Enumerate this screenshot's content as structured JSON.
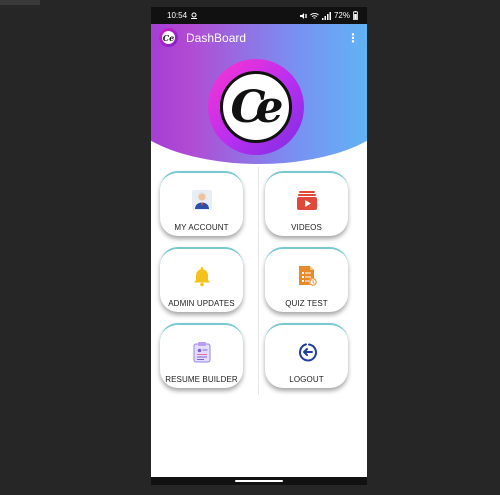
{
  "status_bar": {
    "time": "10:54",
    "battery": "72%",
    "icons": [
      "carrier-icon",
      "mute-icon",
      "wifi-icon",
      "signal-icon",
      "battery-icon"
    ]
  },
  "appbar": {
    "logo_text": "Ce",
    "title": "DashBoard",
    "menu_icon": "⋮"
  },
  "hero": {
    "logo_text": "Ce",
    "colors": {
      "purple": "#9b34d6",
      "blue": "#57c1f6",
      "magenta": "#ff33d2"
    }
  },
  "tiles": [
    {
      "label": "MY ACCOUNT",
      "icon": "user-account-icon"
    },
    {
      "label": "VIDEOS",
      "icon": "video-playlist-icon"
    },
    {
      "label": "ADMIN UPDATES",
      "icon": "bell-icon"
    },
    {
      "label": "QUIZ TEST",
      "icon": "quiz-document-icon"
    },
    {
      "label": "RESUME BUILDER",
      "icon": "clipboard-resume-icon"
    },
    {
      "label": "LOGOUT",
      "icon": "logout-icon"
    }
  ]
}
